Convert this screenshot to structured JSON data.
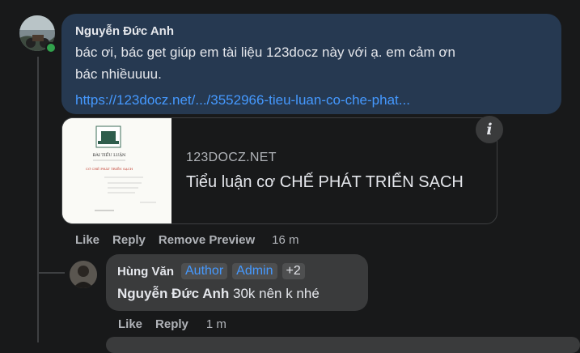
{
  "comment": {
    "author": "Nguyễn Đức Anh",
    "message": "bác ơi, bác get giúp em tài liệu 123docz này với ạ. em cảm ơn\nbác nhiềuuuu.",
    "link_text": "https://123docz.net/.../3552966-tieu-luan-co-che-phat...",
    "actions": {
      "like": "Like",
      "reply": "Reply",
      "remove_preview": "Remove Preview",
      "time": "16 m"
    }
  },
  "preview": {
    "domain": "123DOCZ.NET",
    "title": "Tiểu luận cơ CHẾ PHÁT TRIỂN SẠCH",
    "info_icon": "info-icon",
    "thumbnail_text": {
      "heading": "BÀI TIỂU LUẬN",
      "subheading": "CƠ CHẾ PHÁT TRIỂN SẠCH"
    }
  },
  "reply": {
    "author": "Hùng Văn",
    "badges": [
      "Author",
      "Admin",
      "+2"
    ],
    "mention": "Nguyễn Đức Anh",
    "text": "30k nên k nhé",
    "actions": {
      "like": "Like",
      "reply": "Reply",
      "time": "1 m"
    }
  },
  "colors": {
    "bubble_main": "#263951",
    "bubble_reply": "#3a3b3c",
    "link": "#4599ff",
    "online": "#31a24c"
  }
}
